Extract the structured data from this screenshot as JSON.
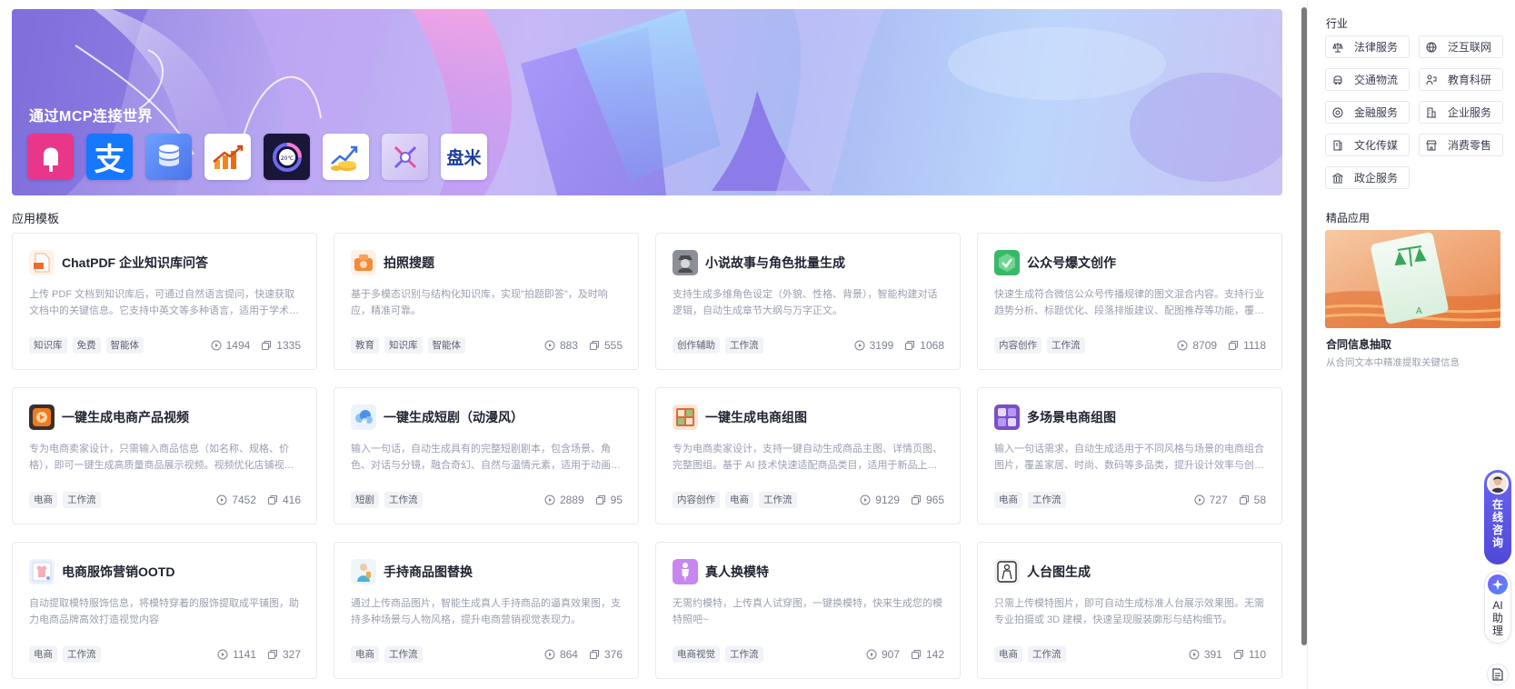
{
  "banner": {
    "title": "通过MCP连接世界",
    "logos": [
      {
        "name": "popsicle-logo-icon",
        "bg": "#e8368b"
      },
      {
        "name": "alipay-logo-icon",
        "bg": "#1677ff",
        "glyph": "支"
      },
      {
        "name": "database-logo-icon",
        "bg": "#5b8df5"
      },
      {
        "name": "stock-chart-logo-icon",
        "bg": "#ffffff"
      },
      {
        "name": "circle-gauge-logo-icon",
        "bg": "#1a1638",
        "glyph": "20℃"
      },
      {
        "name": "money-growth-logo-icon",
        "bg": "#ffffff"
      },
      {
        "name": "satellite-logo-icon",
        "bg": "#d9d2f5"
      },
      {
        "name": "panmi-logo-icon",
        "bg": "#ffffff",
        "glyph": "盘米"
      }
    ]
  },
  "section_title": "应用模板",
  "cards": [
    {
      "title": "ChatPDF 企业知识库问答",
      "icon": "pdf-doc-icon",
      "icon_bg": "#fff3ea",
      "desc": "上传 PDF 文档到知识库后，可通过自然语言提问，快速获取文档中的关键信息。它支持中英文等多种语言，适用于学术研究、企业知识管理等场景。",
      "tags": [
        "知识库",
        "免费",
        "智能体"
      ],
      "views": "1494",
      "copies": "1335"
    },
    {
      "title": "拍照搜题",
      "icon": "camera-bag-icon",
      "icon_bg": "#fff1e6",
      "desc": "基于多模态识别与结构化知识库，实现\"拍题即答\"，及时响应，精准可靠。",
      "tags": [
        "教育",
        "知识库",
        "智能体"
      ],
      "views": "883",
      "copies": "555"
    },
    {
      "title": "小说故事与角色批量生成",
      "icon": "detective-icon",
      "icon_bg": "#8d8f96",
      "desc": "支持生成多维角色设定（外貌、性格、背景），智能构建对话逻辑，自动生成章节大纲与万字正文。",
      "tags": [
        "创作辅助",
        "工作流"
      ],
      "views": "3199",
      "copies": "1068"
    },
    {
      "title": "公众号爆文创作",
      "icon": "green-badge-icon",
      "icon_bg": "#39b86a",
      "desc": "快速生成符合微信公众号传播规律的图文混合内容。支持行业趋势分析、标题优化、段落排版建议、配图推荐等功能，覆盖多种垂直领域。",
      "tags": [
        "内容创作",
        "工作流"
      ],
      "views": "8709",
      "copies": "1118"
    },
    {
      "title": "一键生成电商产品视频",
      "icon": "video-play-icon",
      "icon_bg": "#3a2f2a",
      "desc": "专为电商卖家设计，只需输入商品信息（如名称、规格、价格），即可一键生成高质量商品展示视频。视频优化店铺视觉效果。",
      "tags": [
        "电商",
        "工作流"
      ],
      "views": "7452",
      "copies": "416"
    },
    {
      "title": "一键生成短剧（动漫风）",
      "icon": "anime-cloud-icon",
      "icon_bg": "#eaf3ff",
      "desc": "输入一句话，自动生成具有的完整短剧剧本，包含场景、角色、对话与分镜，融合奇幻、自然与温情元素，适用于动画短片创作。",
      "tags": [
        "短剧",
        "工作流"
      ],
      "views": "2889",
      "copies": "95"
    },
    {
      "title": "一键生成电商组图",
      "icon": "product-grid-icon",
      "icon_bg": "#fbe4d6",
      "desc": "专为电商卖家设计，支持一键自动生成商品主图、详情页图、完整图组。基于 AI 技术快速适配商品类目，适用于新品上架场景。",
      "tags": [
        "内容创作",
        "电商",
        "工作流"
      ],
      "views": "9129",
      "copies": "965"
    },
    {
      "title": "多场景电商组图",
      "icon": "multi-scene-icon",
      "icon_bg": "#7a4fc9",
      "desc": "输入一句话需求，自动生成适用于不同风格与场景的电商组合图片，覆盖家居、时尚、数码等多品类，提升设计效率与创意表现。",
      "tags": [
        "电商",
        "工作流"
      ],
      "views": "727",
      "copies": "58"
    },
    {
      "title": "电商服饰营销OOTD",
      "icon": "fashion-board-icon",
      "icon_bg": "#eaf2fb",
      "desc": "自动提取模特服饰信息，将模特穿着的服饰提取成平铺图，助力电商品牌高效打造视觉内容",
      "tags": [
        "电商",
        "工作流"
      ],
      "views": "1141",
      "copies": "327"
    },
    {
      "title": "手持商品图替换",
      "icon": "hand-model-icon",
      "icon_bg": "#eef6fb",
      "desc": "通过上传商品图片，智能生成真人手持商品的逼真效果图，支持多种场景与人物风格，提升电商营销视觉表现力。",
      "tags": [
        "电商",
        "工作流"
      ],
      "views": "864",
      "copies": "376"
    },
    {
      "title": "真人换模特",
      "icon": "model-figure-icon",
      "icon_bg": "#c887ef",
      "desc": "无需约模特，上传真人试穿图，一键换模特，快来生成您的模特照吧~",
      "tags": [
        "电商视觉",
        "工作流"
      ],
      "views": "907",
      "copies": "142"
    },
    {
      "title": "人台图生成",
      "icon": "mannequin-icon",
      "icon_bg": "#f1f1f1",
      "desc": "只需上传模特图片，即可自动生成标准人台展示效果图。无需专业拍摄或 3D 建模，快速呈现服装廓形与结构细节。",
      "tags": [
        "电商",
        "工作流"
      ],
      "views": "391",
      "copies": "110"
    }
  ],
  "sidebar": {
    "industry_title": "行业",
    "industries": [
      {
        "label": "法律服务",
        "icon": "scale-icon"
      },
      {
        "label": "泛互联网",
        "icon": "globe-icon"
      },
      {
        "label": "交通物流",
        "icon": "truck-icon"
      },
      {
        "label": "教育科研",
        "icon": "teacher-icon"
      },
      {
        "label": "金融服务",
        "icon": "coin-icon"
      },
      {
        "label": "企业服务",
        "icon": "building-icon"
      },
      {
        "label": "文化传媒",
        "icon": "book-icon"
      },
      {
        "label": "消费零售",
        "icon": "shop-icon"
      },
      {
        "label": "政企服务",
        "icon": "government-icon"
      }
    ],
    "featured_title": "精品应用",
    "featured": {
      "title": "合同信息抽取",
      "desc": "从合同文本中精准提取关键信息"
    }
  },
  "floating": {
    "consult_label": "在线咨询",
    "ai_label": "AI助理"
  }
}
